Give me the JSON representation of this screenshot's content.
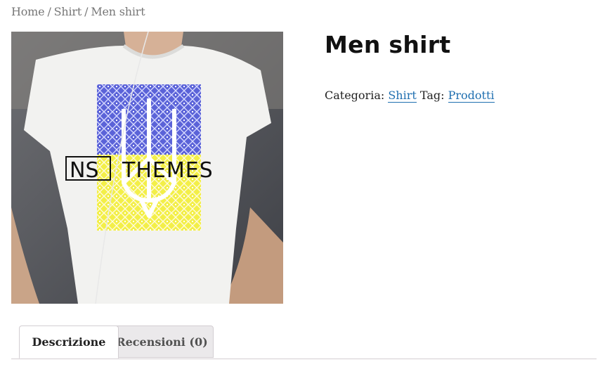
{
  "breadcrumb": {
    "home": "Home",
    "category": "Shirt",
    "current": "Men shirt",
    "separator": "/"
  },
  "product": {
    "title": "Men shirt",
    "category_label": "Categoria:",
    "category_link": "Shirt",
    "tag_label": "Tag:",
    "tag_link": "Prodotti",
    "image_alt": "NS THEMES",
    "image_logo_box": "NS",
    "image_logo_text": "THEMES"
  },
  "tabs": [
    {
      "label": "Descrizione",
      "active": true
    },
    {
      "label": "Recensioni (0)",
      "active": false
    }
  ],
  "colors": {
    "link": "#1f6fb0",
    "tab_inactive_bg": "#ebe9eb",
    "border": "#d3ced2"
  }
}
